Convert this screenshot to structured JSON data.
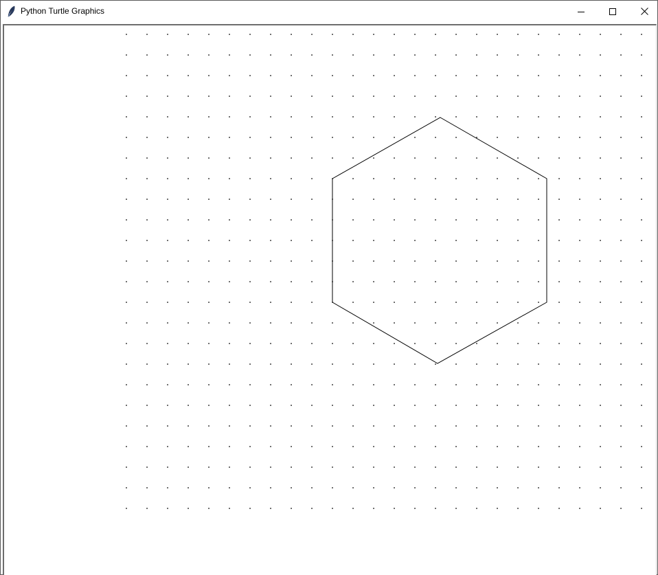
{
  "window": {
    "title": "Python Turtle Graphics",
    "controls": {
      "minimize_icon": "minimize-icon",
      "maximize_icon": "maximize-icon",
      "close_icon": "close-icon"
    }
  },
  "canvas": {
    "background": "#ffffff",
    "dot_color": "#000000",
    "line_color": "#000000",
    "shapes": [
      "dot-grid",
      "hexagon"
    ]
  }
}
